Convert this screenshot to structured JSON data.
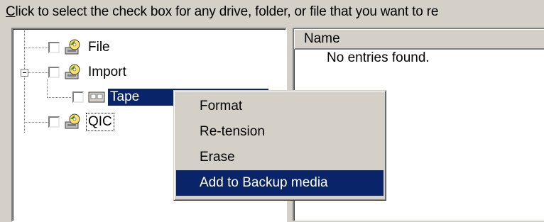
{
  "instruction": {
    "accel": "C",
    "rest": "lick to select the check box for any drive, folder, or file that you want to re"
  },
  "tree": {
    "items": [
      {
        "label": "File",
        "icon": "tape-device-icon"
      },
      {
        "label": "Import",
        "icon": "tape-device-icon"
      },
      {
        "label": "Tape",
        "icon": "tape-media-icon"
      },
      {
        "label": "QIC",
        "icon": "tape-device-icon"
      }
    ]
  },
  "list": {
    "column_name": "Name",
    "empty_message": "No entries found."
  },
  "context_menu": {
    "items": [
      "Format",
      "Re-tension",
      "Erase",
      "Add to Backup media"
    ],
    "highlighted": "Add to Backup media"
  },
  "colors": {
    "face": "#d4d0c8",
    "selection": "#0a246a"
  }
}
